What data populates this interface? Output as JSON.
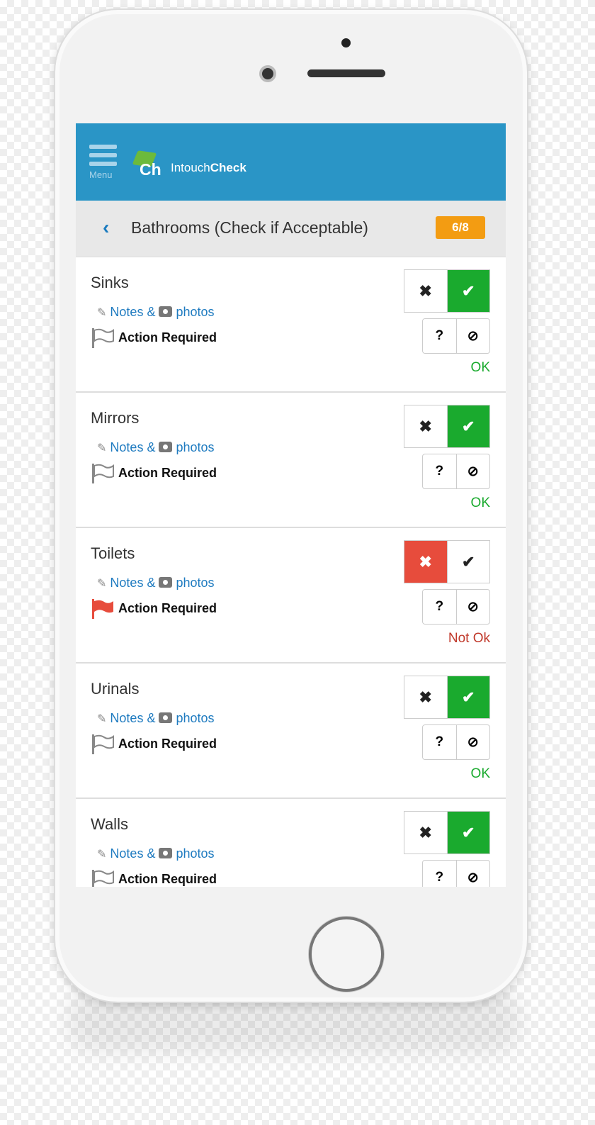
{
  "app": {
    "menu_label": "Menu",
    "logo_mark": "Ch",
    "brand_prefix": "Intouch",
    "brand_suffix": "Check"
  },
  "section": {
    "title": "Bathrooms (Check if Acceptable)",
    "progress": "6/8"
  },
  "colors": {
    "header": "#2a95c6",
    "accent_orange": "#f39c12",
    "ok_green": "#1aaa2e",
    "not_ok_red": "#e74c3c",
    "link": "#1f7bc0"
  },
  "labels": {
    "notes": "Notes &",
    "photos": "photos",
    "action_required": "Action Required",
    "question": "?",
    "fail_glyph": "✖",
    "pass_glyph": "✔",
    "na_glyph": "⊘"
  },
  "items": [
    {
      "title": "Sinks",
      "state": "pass",
      "flagged": false,
      "status": "OK"
    },
    {
      "title": "Mirrors",
      "state": "pass",
      "flagged": false,
      "status": "OK"
    },
    {
      "title": "Toilets",
      "state": "fail",
      "flagged": true,
      "status": "Not Ok"
    },
    {
      "title": "Urinals",
      "state": "pass",
      "flagged": false,
      "status": "OK"
    },
    {
      "title": "Walls",
      "state": "pass",
      "flagged": false,
      "status": ""
    }
  ]
}
